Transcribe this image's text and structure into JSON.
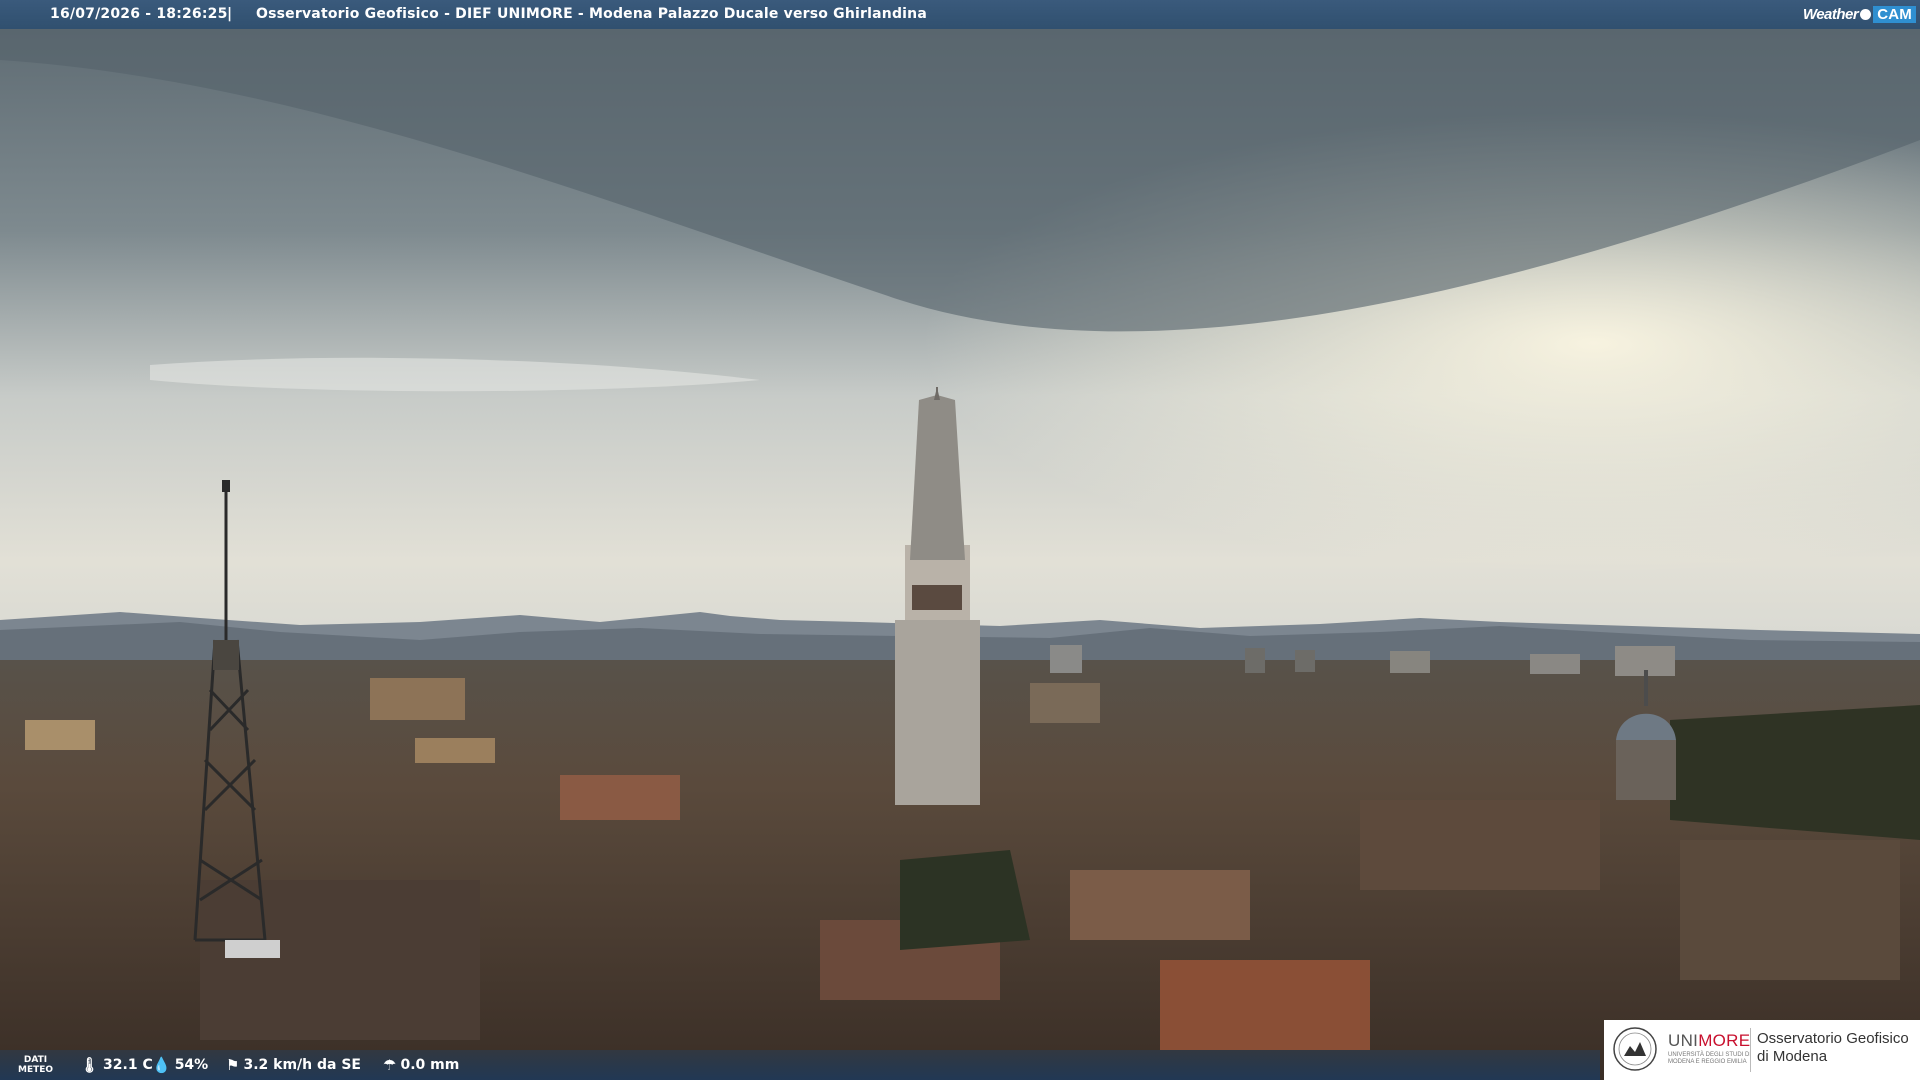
{
  "overlay": {
    "datetime": "16/07/2026 - 18:26:25",
    "separator": "|",
    "title": "Osservatorio Geofisico - DIEF UNIMORE - Modena Palazzo Ducale verso Ghirlandina"
  },
  "brand": {
    "weather": "Weather",
    "cam": "CAM"
  },
  "weather": {
    "label_line1": "DATI",
    "label_line2": "METEO",
    "temperature": "32.1 C",
    "humidity": "54%",
    "wind": "3.2 km/h da SE",
    "rain": "0.0 mm",
    "icons": [
      "thermometer-icon",
      "humidity-icon",
      "wind-icon",
      "rain-gauge-icon"
    ]
  },
  "institution": {
    "uni": "UNI",
    "more": "MORE",
    "sub1": "UNIVERSITÀ DEGLI STUDI DI",
    "sub2": "MODENA E REGGIO EMILIA",
    "observatory_line1": "Osservatorio Geofisico",
    "observatory_line2": "di Modena"
  },
  "colors": {
    "bar": "#30506f",
    "accent": "#2f8fd0",
    "unimore_red": "#c8102e"
  }
}
